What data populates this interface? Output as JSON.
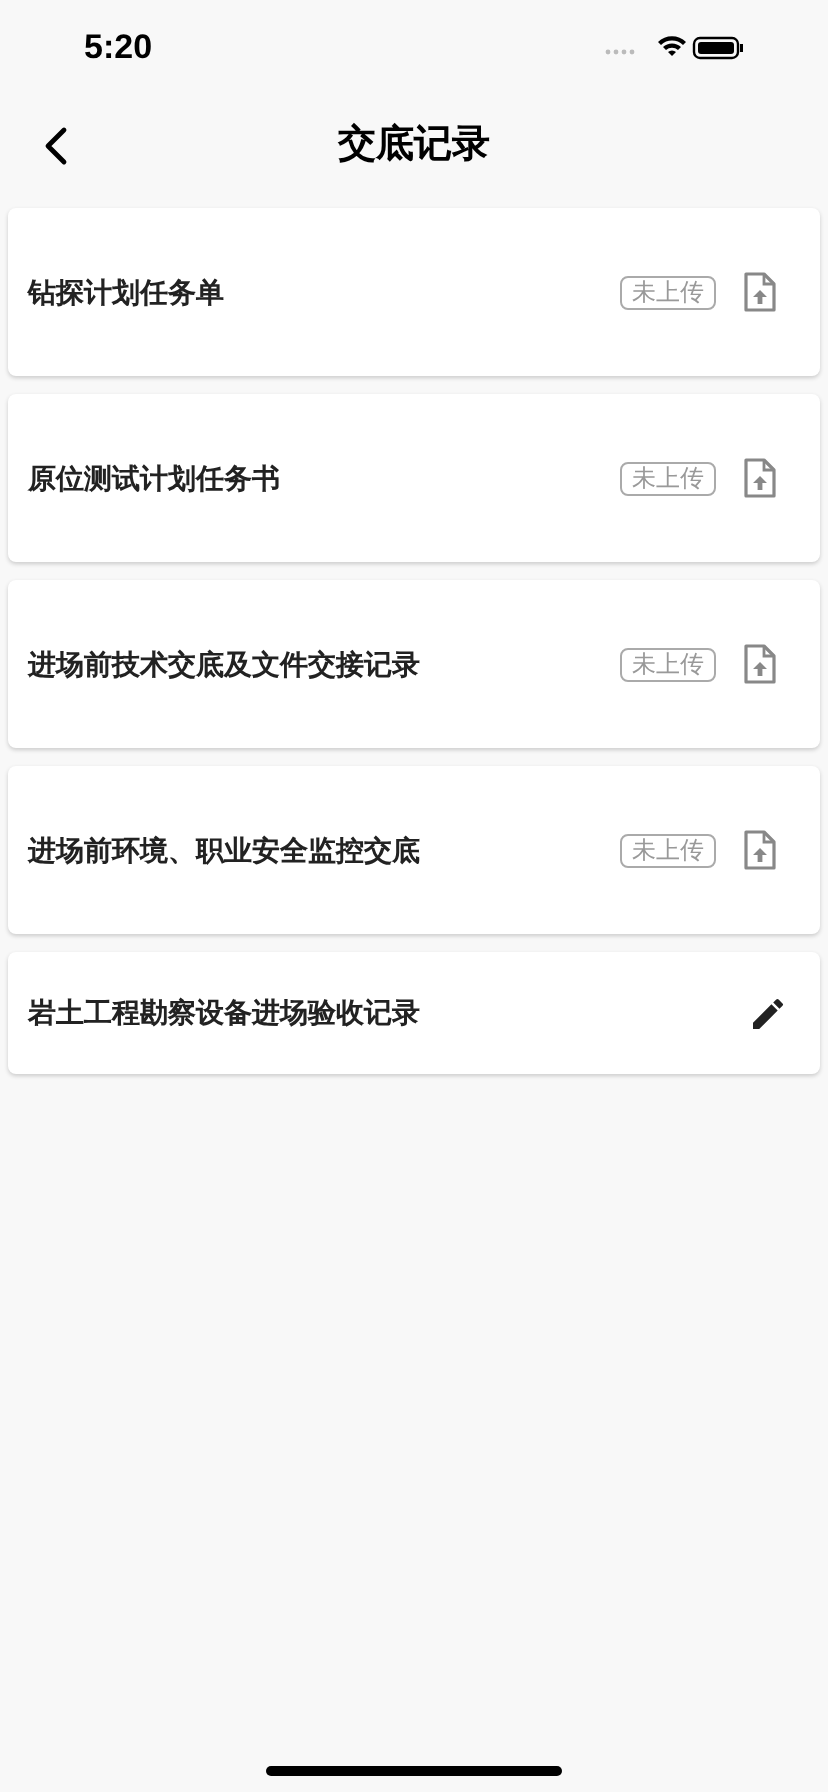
{
  "status_bar": {
    "time": "5:20"
  },
  "header": {
    "title": "交底记录"
  },
  "records": [
    {
      "kind": "upload",
      "title": "钻探计划任务单",
      "status": "未上传"
    },
    {
      "kind": "upload",
      "title": "原位测试计划任务书",
      "status": "未上传"
    },
    {
      "kind": "upload",
      "title": "进场前技术交底及文件交接记录",
      "status": "未上传"
    },
    {
      "kind": "upload",
      "title": "进场前环境、职业安全监控交底",
      "status": "未上传"
    },
    {
      "kind": "edit",
      "title": "岩土工程勘察设备进场验收记录"
    }
  ]
}
